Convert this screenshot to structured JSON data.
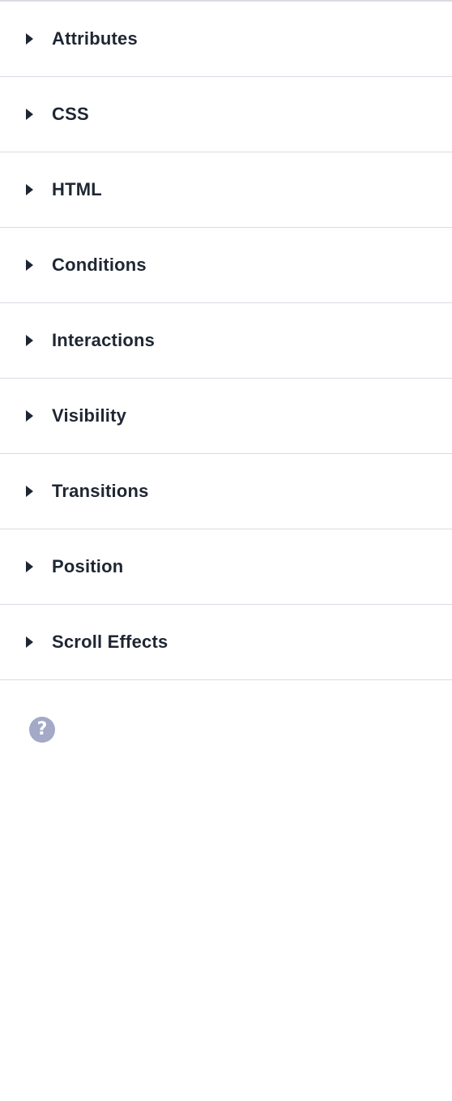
{
  "sections": [
    {
      "label": "Attributes"
    },
    {
      "label": "CSS"
    },
    {
      "label": "HTML"
    },
    {
      "label": "Conditions"
    },
    {
      "label": "Interactions"
    },
    {
      "label": "Visibility"
    },
    {
      "label": "Transitions"
    },
    {
      "label": "Position"
    },
    {
      "label": "Scroll Effects"
    }
  ],
  "help": {
    "icon": "question-circle-icon",
    "glyph": "?"
  },
  "colors": {
    "text": "#1f2633",
    "divider": "#d9dce6",
    "help_icon_bg": "#a3a9c7"
  }
}
